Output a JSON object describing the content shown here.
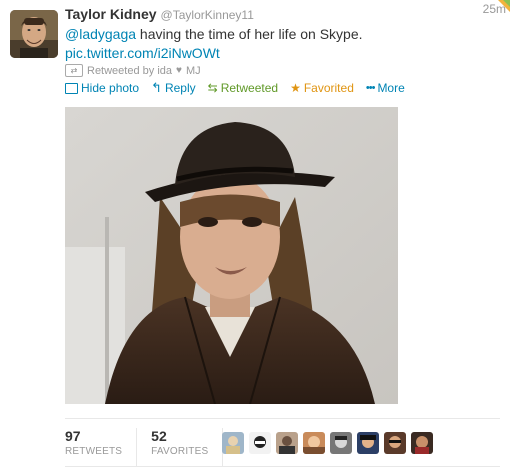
{
  "tweet": {
    "fullname": "Taylor Kidney",
    "username": "@TaylorKinney11",
    "time": "25m",
    "mention": "@ladygaga",
    "text": " having the time of her life on Skype.",
    "pic_link": "pic.twitter.com/i2iNwOWt",
    "retweeted_by": "Retweeted by ida",
    "retweeted_by_suffix": "MJ"
  },
  "actions": {
    "hide_photo": "Hide photo",
    "reply": "Reply",
    "retweeted": "Retweeted",
    "favorited": "Favorited",
    "more": "More"
  },
  "stats": {
    "retweets_count": "97",
    "retweets_label": "RETWEETS",
    "favorites_count": "52",
    "favorites_label": "FAVORITES"
  },
  "colors": {
    "link": "#0084b4",
    "retweeted": "#609928",
    "favorited": "#e09513",
    "muted": "#999999"
  },
  "icons": [
    "photo-icon",
    "reply-icon",
    "retweet-icon",
    "star-icon",
    "more-icon",
    "heart-icon"
  ]
}
